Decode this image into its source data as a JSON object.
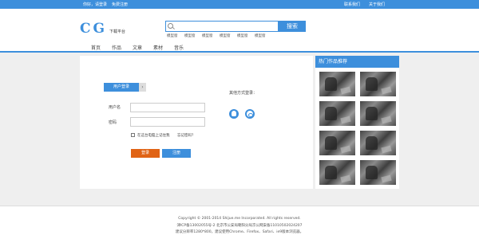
{
  "topbar": {
    "greeting": "你好，请登录",
    "register_link": "免费注册",
    "contact": "联系我们",
    "about": "关于我们"
  },
  "header": {
    "logo_text": "CG",
    "logo_subtitle": "下载平台",
    "search_placeholder": "",
    "search_button": "搜索",
    "hot_tags": [
      "模型窗",
      "模型窗",
      "模型窗",
      "模型窗",
      "模型窗",
      "模型窗"
    ]
  },
  "nav": {
    "items": [
      "首页",
      "作品",
      "文章",
      "素材",
      "音乐"
    ]
  },
  "login": {
    "tab_label": "用户登录",
    "tab_arrow": "›",
    "username_label": "用户名",
    "username_value": "",
    "password_label": "密码",
    "password_value": "",
    "remember_label": "在这台电脑上记住我",
    "forgot_label": "忘记密码？",
    "login_button": "登录",
    "register_button": "注册",
    "other_login_label": "其他方式登录："
  },
  "sidebar": {
    "title": "热门作品推荐",
    "thumbnail_count": 8
  },
  "footer": {
    "copyright": "Copyright © 2001-2014 Shijue.me Incorporated. All rights reserved.",
    "icp": "津ICP备13002055号-2    北京市公安局朝阳分局京公网安备11010502024207",
    "browser_tip": "建议分辨率1280*800，建议使用Chrome、Firefox、Safari、ie9版本浏览器。"
  }
}
